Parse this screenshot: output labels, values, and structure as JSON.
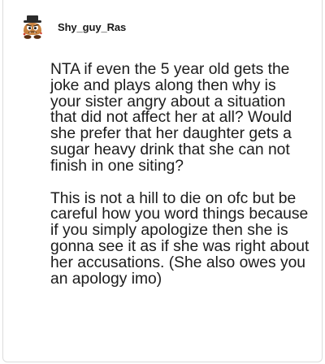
{
  "comment": {
    "username": "Shy_guy_Ras",
    "avatar_icon": "avatar-goomba-with-hat",
    "paragraphs": [
      "NTA if even the 5 year old gets the joke and plays along then why is your sister angry about a situation that did not affect her at all? Would she prefer that her daughter gets a sugar heavy drink that she can not finish in one siting?",
      "This is not a hill to die on ofc but be careful how you word things because if you simply apologize then she is gonna see it as if she was right about her accusations. (She also owes you an apology imo)"
    ]
  }
}
